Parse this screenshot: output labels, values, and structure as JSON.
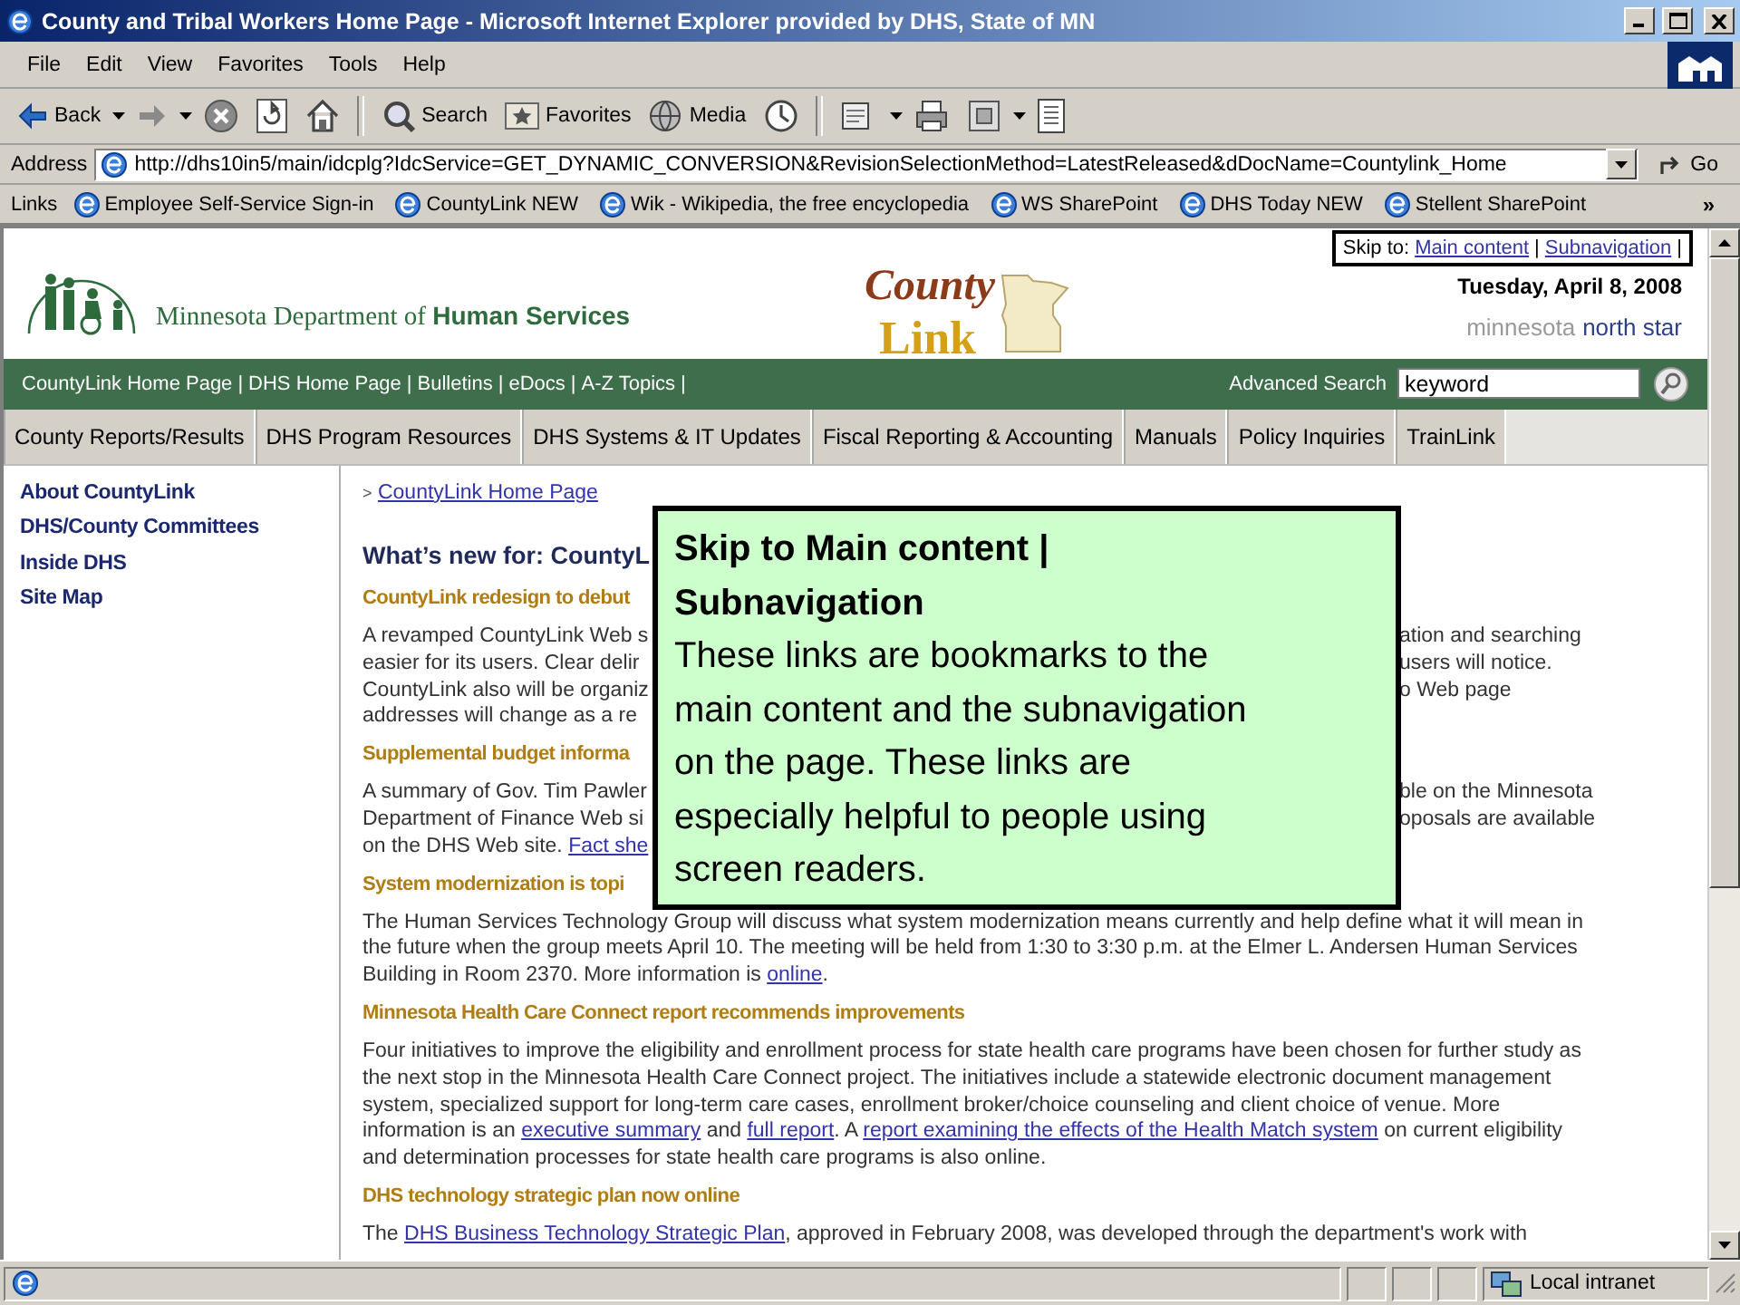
{
  "window": {
    "title": "County and Tribal Workers Home Page - Microsoft Internet Explorer provided by DHS, State of MN"
  },
  "menu": [
    "File",
    "Edit",
    "View",
    "Favorites",
    "Tools",
    "Help"
  ],
  "toolbar": [
    {
      "kind": "back",
      "label": "Back"
    },
    {
      "kind": "forward"
    },
    {
      "kind": "stop"
    },
    {
      "kind": "refresh"
    },
    {
      "kind": "home"
    },
    {
      "kind": "search",
      "label": "Search"
    },
    {
      "kind": "favorites",
      "label": "Favorites"
    },
    {
      "kind": "media",
      "label": "Media"
    },
    {
      "kind": "history"
    },
    {
      "kind": "mail"
    },
    {
      "kind": "print"
    },
    {
      "kind": "edit"
    },
    {
      "kind": "discuss"
    }
  ],
  "address": {
    "label": "Address",
    "url": "http://dhs10in5/main/idcplg?IdcService=GET_DYNAMIC_CONVERSION&RevisionSelectionMethod=LatestReleased&dDocName=Countylink_Home",
    "go": "Go"
  },
  "links_bar": {
    "label": "Links",
    "items": [
      "Employee Self-Service Sign-in",
      "CountyLink NEW",
      "Wik - Wikipedia, the free encyclopedia",
      "WS SharePoint",
      "DHS Today NEW",
      "Stellent SharePoint"
    ],
    "more": "»"
  },
  "page": {
    "skip_links": {
      "label": "Skip to:",
      "links": [
        "Main content",
        "Subnavigation"
      ],
      "separator": "|"
    },
    "agency": "Minnesota Department of **Human Services**",
    "logo": {
      "word_1": "County",
      "word_2": "Link"
    },
    "date": "Tuesday, April 8, 2008",
    "brand": {
      "word_1": "minnesota",
      "word_2": "north star"
    },
    "top_links": [
      "CountyLink Home Page",
      "DHS Home Page",
      "Bulletins",
      "eDocs",
      "A-Z Topics"
    ],
    "top_separator": "|",
    "search": {
      "label": "Advanced Search",
      "value": "keyword"
    },
    "tabs": [
      "County Reports/Results",
      "DHS Program Resources",
      "DHS Systems & IT Updates",
      "Fiscal Reporting & Accounting",
      "Manuals",
      "Policy Inquiries",
      "TrainLink"
    ],
    "sidebar": [
      "About CountyLink",
      "DHS/County Committees",
      "Inside DHS",
      "Site Map"
    ],
    "breadcrumb": {
      "marker": ">",
      "link": "CountyLink Home Page"
    },
    "article": [
      {
        "kind": "headline",
        "text": "What’s new for: CountyL"
      },
      {
        "kind": "heading",
        "text": "CountyLink redesign to debut"
      },
      {
        "kind": "covered",
        "lines": [
          {
            "left": [
              "A revamped CountyLink Web s"
            ],
            "right": "ation and searching"
          },
          {
            "left": [
              "easier for its users. Clear delir"
            ],
            "right": "users will notice."
          },
          {
            "left": [
              "CountyLink also will be organiz"
            ],
            "right": "o Web page"
          },
          {
            "left": [
              "addresses will change as a re"
            ]
          }
        ]
      },
      {
        "kind": "heading",
        "text": "Supplemental budget informa"
      },
      {
        "kind": "covered",
        "lines": [
          {
            "left": [
              "A summary of Gov. Tim Pawler"
            ],
            "right": "ble on the Minnesota"
          },
          {
            "left": [
              "Department of Finance Web si"
            ],
            "right": "oposals are available"
          },
          {
            "left": [
              "on the DHS Web site. ",
              {
                "link": "Fact she"
              }
            ]
          }
        ]
      },
      {
        "kind": "heading",
        "text": "System modernization is topi"
      },
      {
        "kind": "paragraph",
        "lines": [
          [
            "The Human Services Technology Group will discuss what system modernization means currently and help define what it will mean in"
          ],
          [
            "the future when the group meets April 10. The meeting will be held from 1:30 to 3:30 p.m. at the Elmer L. Andersen Human Services"
          ],
          [
            "Building in Room 2370. More information is ",
            {
              "link": "online"
            },
            "."
          ]
        ]
      },
      {
        "kind": "heading",
        "text": "Minnesota Health Care Connect report recommends improvements"
      },
      {
        "kind": "paragraph",
        "lines": [
          [
            "Four initiatives to improve the eligibility and enrollment process for state health care programs have been chosen for further study as"
          ],
          [
            "the next stop in the Minnesota Health Care Connect project. The initiatives include a statewide electronic document management"
          ],
          [
            "system, specialized support for long-term care cases, enrollment broker/choice counseling and client choice of venue. More"
          ],
          [
            "information is an ",
            {
              "link": "executive summary"
            },
            " and ",
            {
              "link": "full report"
            },
            ". A ",
            {
              "link": "report examining the effects of the Health Match system"
            },
            " on current eligibility"
          ],
          [
            "and determination processes for state health care programs is also online."
          ]
        ]
      },
      {
        "kind": "heading",
        "text": "DHS technology strategic plan now online"
      },
      {
        "kind": "paragraph",
        "lines": [
          [
            "The ",
            {
              "link": "DHS Business Technology Strategic Plan"
            },
            ", approved in February 2008, was developed through the department's work with"
          ]
        ]
      }
    ]
  },
  "callout": {
    "title_lines": [
      "Skip to Main content |",
      "Subnavigation"
    ],
    "body_lines": [
      "These links are bookmarks to the",
      "main content and the subnavigation",
      "on the page. These links are",
      "especially helpful to people using",
      "screen readers."
    ]
  },
  "status_bar": {
    "zone": "Local intranet"
  }
}
